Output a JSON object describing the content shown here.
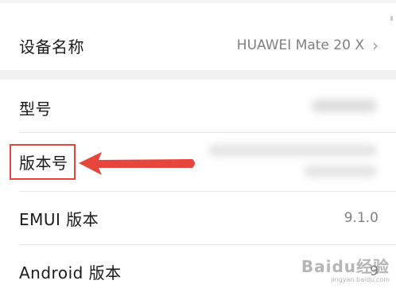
{
  "settings": {
    "rows": [
      {
        "label": "设备名称",
        "value": "HUAWEI Mate 20 X",
        "chevron": "›"
      },
      {
        "label": "型号"
      },
      {
        "label": "版本号"
      },
      {
        "label": "EMUI 版本",
        "value": "9.1.0"
      },
      {
        "label": "Android 版本",
        "value": "9"
      }
    ]
  },
  "annotation": {
    "highlight_color": "#e8453c",
    "arrow_color": "#e8453c"
  },
  "watermark": {
    "brand": "Baidu经验",
    "url": "jingyan.baidu.com"
  }
}
